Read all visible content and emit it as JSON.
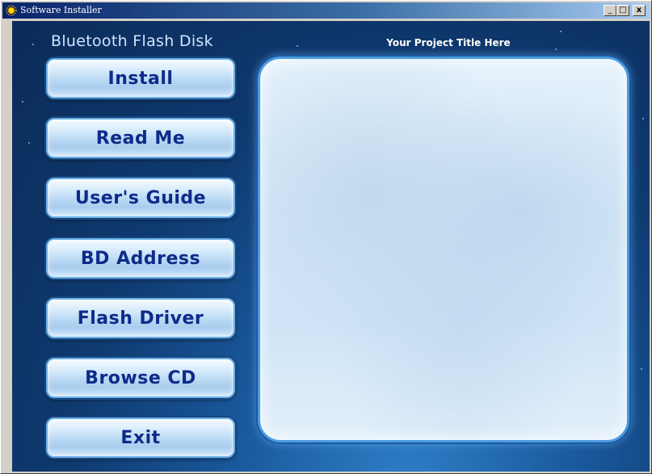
{
  "window": {
    "title": "Software Installer",
    "controls": {
      "minimize": "_",
      "maximize": "□",
      "close": "x"
    },
    "icon": "sun-app-icon"
  },
  "header": {
    "product_name": "Bluetooth Flash Disk",
    "project_title": "Your Project Title Here"
  },
  "menu": {
    "items": [
      {
        "label": "Install"
      },
      {
        "label": "Read Me"
      },
      {
        "label": "User's Guide"
      },
      {
        "label": "BD Address"
      },
      {
        "label": "Flash Driver"
      },
      {
        "label": "Browse CD"
      },
      {
        "label": "Exit"
      }
    ]
  },
  "colors": {
    "title_bar": "#0a246a",
    "background": "#0f3a70",
    "button_text": "#0e2b8a",
    "panel": "#d3e7f7"
  }
}
